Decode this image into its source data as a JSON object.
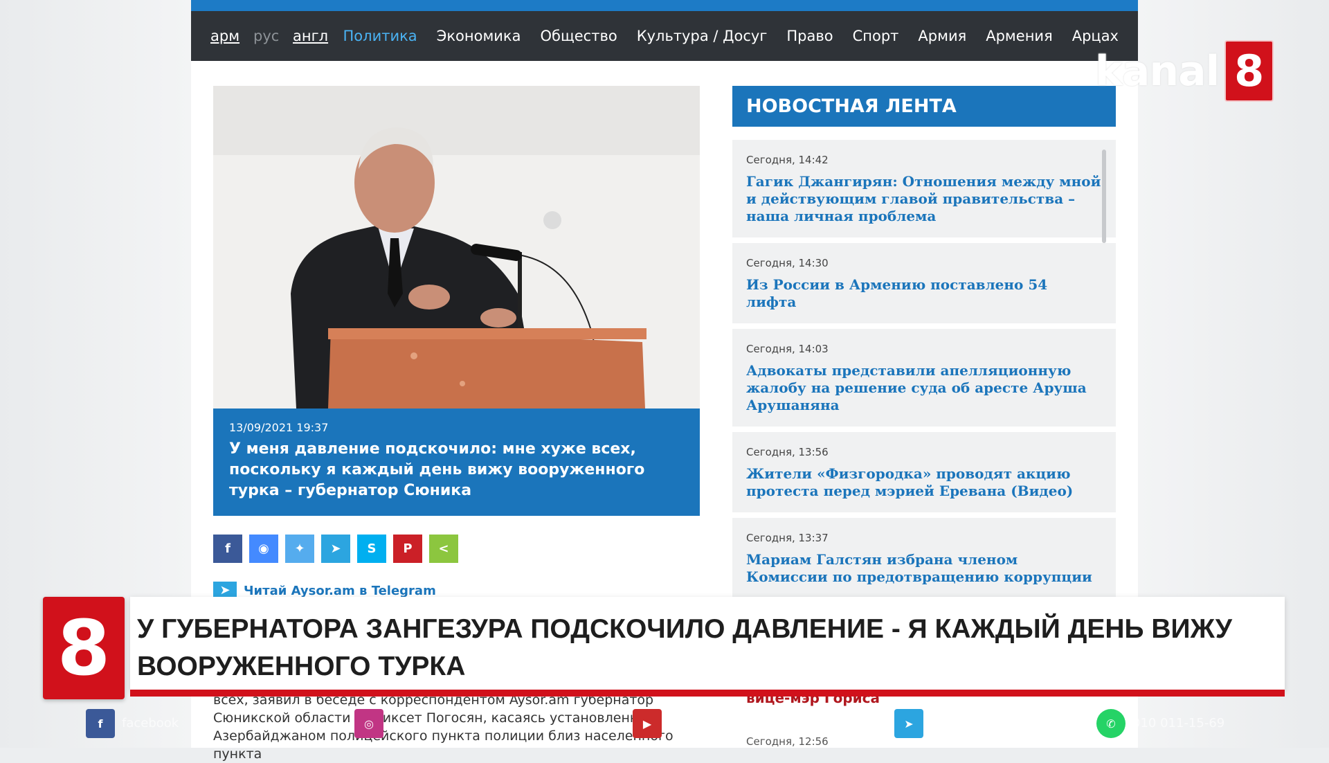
{
  "nav": {
    "langs": [
      "арм",
      "рус",
      "англ"
    ],
    "items": [
      "Политика",
      "Экономика",
      "Общество",
      "Культура / Досуг",
      "Право",
      "Спорт",
      "Армия",
      "Армения",
      "Арцах"
    ]
  },
  "article": {
    "date": "13/09/2021 19:37",
    "title": "У меня давление подскочило: мне хуже всех, поскольку я каждый день вижу вооруженного турка – губернатор Сюника"
  },
  "share_icons": [
    "facebook-icon",
    "messenger-icon",
    "twitter-icon",
    "telegram-icon",
    "skype-icon",
    "pinterest-icon",
    "share-icon"
  ],
  "telegram_link": "Читай Aysor.am в Telegram",
  "feed": {
    "heading": "НОВОСТНАЯ ЛЕНТА",
    "items": [
      {
        "time": "Сегодня, 14:42",
        "title": "Гагик Джангирян: Отношения между мной и действующим главой правительства – наша личная проблема"
      },
      {
        "time": "Сегодня, 14:30",
        "title": "Из России в Армению поставлено 54 лифта"
      },
      {
        "time": "Сегодня, 14:03",
        "title": "Адвокаты представили апелляционную жалобу на решение суда об аресте Аруша Арушаняна"
      },
      {
        "time": "Сегодня, 13:56",
        "title": "Жители «Физгородка» проводят акцию протеста перед мэрией Еревана (Видео)"
      },
      {
        "time": "Сегодня, 13:37",
        "title": "Мариам Галстян избрана членом Комиссии по предотвращению коррупции"
      }
    ],
    "partial_time": "Сегодня, 12:56"
  },
  "channel": {
    "logo_text": "kanal",
    "logo_num": "8"
  },
  "ticker": {
    "number": "8",
    "headline": "У ГУБЕРНАТОРА ЗАНГЕЗУРА ПОДСКОЧИЛО ДАВЛЕНИЕ - Я КАЖДЫЙ ДЕНЬ ВИЖУ ВООРУЖЕННОГО ТУРКА"
  },
  "body_fragment": {
    "line1": "всех, заявил в беседе с корреспондентом Aysor.am губернатор",
    "line2": "Сюникской области Меликсет Погосян, касаясь установленного",
    "line3": "Азербайджаном полицейского пункта полиции близ населенного пункта"
  },
  "feed_partial_title": "вице-мэр Гориса",
  "social_bar": {
    "facebook": "facebook",
    "phone": "010 011-15-69"
  },
  "colors": {
    "accent": "#1b75bb",
    "nav_bg": "#2f3338",
    "brand_red": "#d1111b"
  }
}
